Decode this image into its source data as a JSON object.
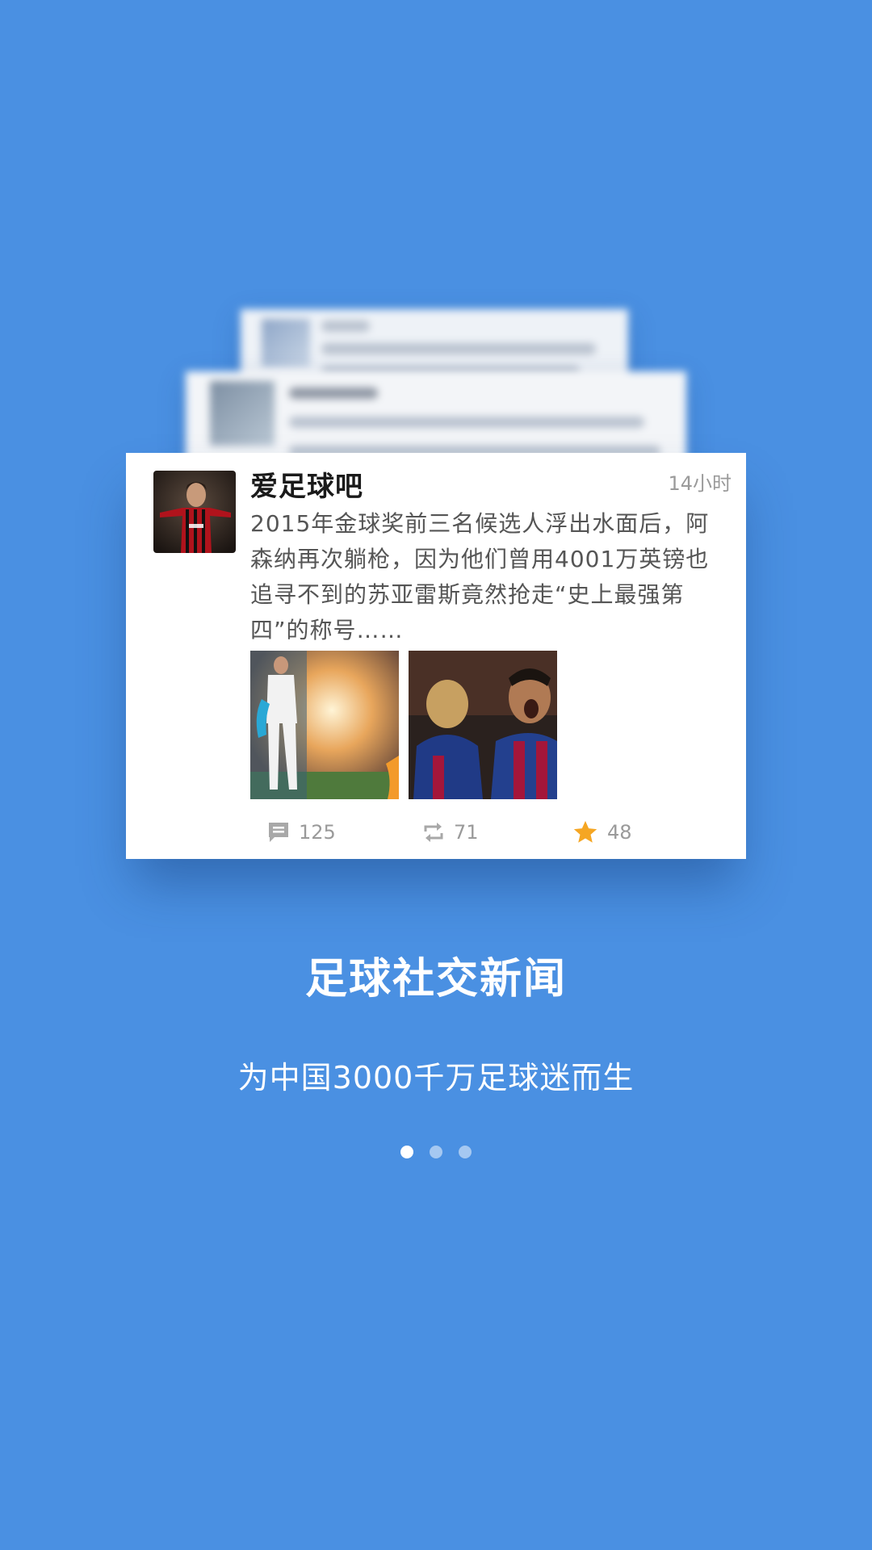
{
  "card": {
    "author": "爱足球吧",
    "timestamp": "14小时",
    "text": "2015年金球奖前三名候选人浮出水面后，阿森纳再次躺枪，因为他们曾用4001万英镑也追寻不到的苏亚雷斯竟然抢走“史上最强第四”的称号……",
    "stats": {
      "comments": "125",
      "reposts": "71",
      "stars": "48"
    },
    "icons": {
      "comments": "comment-icon",
      "reposts": "repost-icon",
      "stars": "star-icon"
    }
  },
  "slogan": {
    "headline": "足球社交新闻",
    "subline": "为中国3000千万足球迷而生"
  },
  "pager": {
    "count": 3,
    "active_index": 0
  },
  "colors": {
    "background": "#4a90e2",
    "star": "#f5a623",
    "muted_text": "#9a9a9a"
  }
}
